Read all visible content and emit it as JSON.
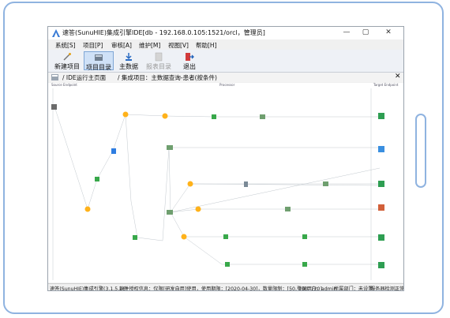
{
  "window": {
    "title": "速答(SunuHIE)集成引擎IDE[db - 192.168.0.105:1521/orcl，管理员]",
    "controls": {
      "minimize": "—",
      "maximize": "▢",
      "close": "✕"
    }
  },
  "menu": [
    "系统[S]",
    "项目[P]",
    "审核[A]",
    "维护[M]",
    "视图[V]",
    "帮助[H]"
  ],
  "toolbar": [
    {
      "label": "新建项目",
      "icon": "new-project-icon",
      "state": "normal"
    },
    {
      "label": "项目目录",
      "icon": "project-catalog-icon",
      "state": "active"
    },
    {
      "label": "主数据",
      "icon": "master-data-icon",
      "state": "normal"
    },
    {
      "label": "报表目录",
      "icon": "report-catalog-icon",
      "state": "disabled"
    },
    {
      "label": "退出",
      "icon": "exit-icon",
      "state": "normal"
    }
  ],
  "tabs": {
    "home": "IDE运行主页面",
    "project": "集成项目：主数据查询-患者(按条件)",
    "close": "✕"
  },
  "canvas": {
    "headers": {
      "source": "Source Endpoint",
      "process": "Processor",
      "target": "Target Endpoint"
    }
  },
  "status": {
    "engine": "速答(SunuHIE)集成引擎(3.1.5.26)",
    "license": "软件授权信息：仅限[研发自用]使用，使用期限：[2020-04-30]，数量限制：[50, 100, 120]",
    "user": "登录用户：admin",
    "dept": "所属部门：未设置",
    "server": "服务器检测正常"
  },
  "colors": {
    "accent": "#8fb3e0",
    "active_tab": "#cfe1f7",
    "link": "#8c9ba8"
  }
}
